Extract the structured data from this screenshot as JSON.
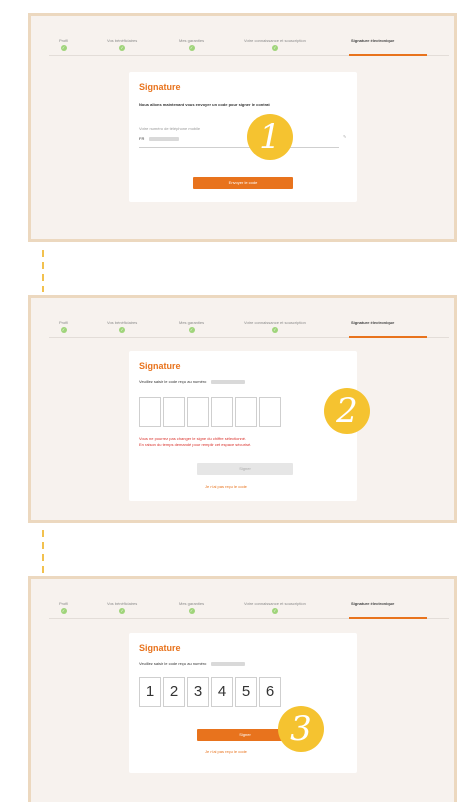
{
  "tabs": [
    {
      "label": "Profil",
      "done": true
    },
    {
      "label": "Vos bénéficiaires",
      "done": true
    },
    {
      "label": "Mes garanties",
      "done": true
    },
    {
      "label": "Votre connaissance et souscription",
      "done": true
    },
    {
      "label": "Signature électronique",
      "done": false
    }
  ],
  "colors": {
    "accent": "#e8731d",
    "badge": "#f5c330",
    "frame_border": "#ecd8bf",
    "dash": "#f2c14e"
  },
  "step1": {
    "title": "Signature",
    "intro": "Nous allons maintenant vous envoyer un code pour signer le contrat",
    "phone_label": "Votre numéro de téléphone mobile",
    "phone_prefix": "FR",
    "button": "Envoyer le code",
    "badge": "1"
  },
  "step2": {
    "title": "Signature",
    "instruction": "Veuillez saisir le code reçu au numéro",
    "error_line1": "Vous ne pourrez pas changer le signe du chiffre sélectionné.",
    "error_line2": "En raison du temps demandé pour remplir cet espace sécurisé.",
    "button": "Signer",
    "resend": "Je n'ai pas reçu le code",
    "badge": "2"
  },
  "step3": {
    "title": "Signature",
    "instruction": "Veuillez saisir le code reçu au numéro",
    "digits": [
      "1",
      "2",
      "3",
      "4",
      "5",
      "6"
    ],
    "button": "Signer",
    "resend": "Je n'ai pas reçu le code",
    "badge": "3"
  }
}
